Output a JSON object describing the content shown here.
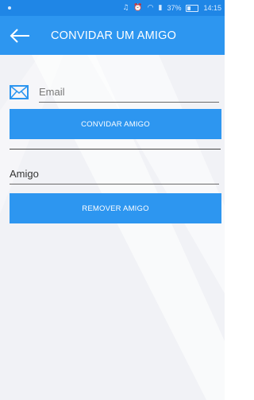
{
  "status_bar": {
    "icons": [
      "sound-icon",
      "alarm-icon",
      "wifi-icon",
      "signal-icon",
      "battery-icon"
    ],
    "battery_text": "37%",
    "battery_level": 0.37,
    "time": "14:15"
  },
  "app_bar": {
    "title": "CONVIDAR UM AMIGO",
    "back_icon": "arrow-left-icon",
    "color": "#2d96f0"
  },
  "invite": {
    "email_placeholder": "Email",
    "email_icon": "mail-icon",
    "button_label": "CONVIDAR AMIGO"
  },
  "remove": {
    "friend_placeholder": "Amigo",
    "button_label": "REMOVER AMIGO"
  }
}
